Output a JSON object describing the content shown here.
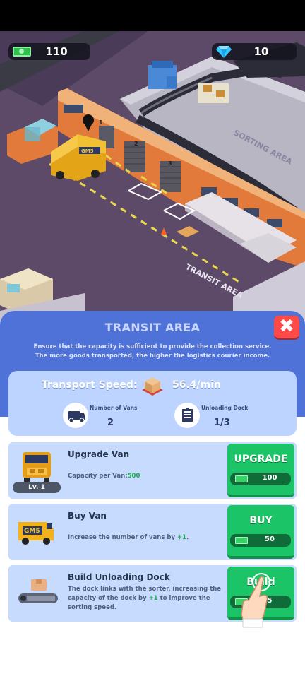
{
  "resources": {
    "cash": "110",
    "gems": "10",
    "cash_icon": "cash-icon",
    "gem_icon": "diamond-icon"
  },
  "scene_labels": {
    "sorting_area": "SORTING AREA",
    "transit_area": "TRANSIT AREA",
    "van_brand": "GM5",
    "dock_numbers": [
      "1",
      "2",
      "3"
    ]
  },
  "panel": {
    "title": "TRANSIT AREA",
    "description": "Ensure that the capacity is sufficient to provide the collection service. The more goods transported, the higher the logistics courier income.",
    "close_icon": "close-icon"
  },
  "stats": {
    "transport_speed_label": "Transport Speed:",
    "transport_speed_value": "56.4/min",
    "vans_label": "Number of Vans",
    "vans_value": "2",
    "dock_label": "Unloading Dock",
    "dock_value": "1/3"
  },
  "upgrades": [
    {
      "title": "Upgrade Van",
      "desc_prefix": "Capacity per Van:",
      "desc_highlight": "500",
      "level": "Lv. 1",
      "button": "UPGRADE",
      "price": "100"
    },
    {
      "title": "Buy Van",
      "desc_prefix": "Increase the number of vans by ",
      "desc_highlight": "+1",
      "desc_suffix": ".",
      "van_brand": "GM5",
      "button": "BUY",
      "price": "50"
    },
    {
      "title": "Build Unloading Dock",
      "desc_prefix": "The dock links with the sorter, increasing the capacity of the dock by ",
      "desc_highlight": "+1",
      "desc_suffix": " to improve the sorting speed.",
      "button": "Build",
      "price": "5"
    }
  ],
  "colors": {
    "panel_header": "#4e72d8",
    "card_bg": "#c7dbff",
    "button_green": "#1bc466",
    "close_red": "#ff4a48",
    "highlight_green": "#18b04a"
  }
}
